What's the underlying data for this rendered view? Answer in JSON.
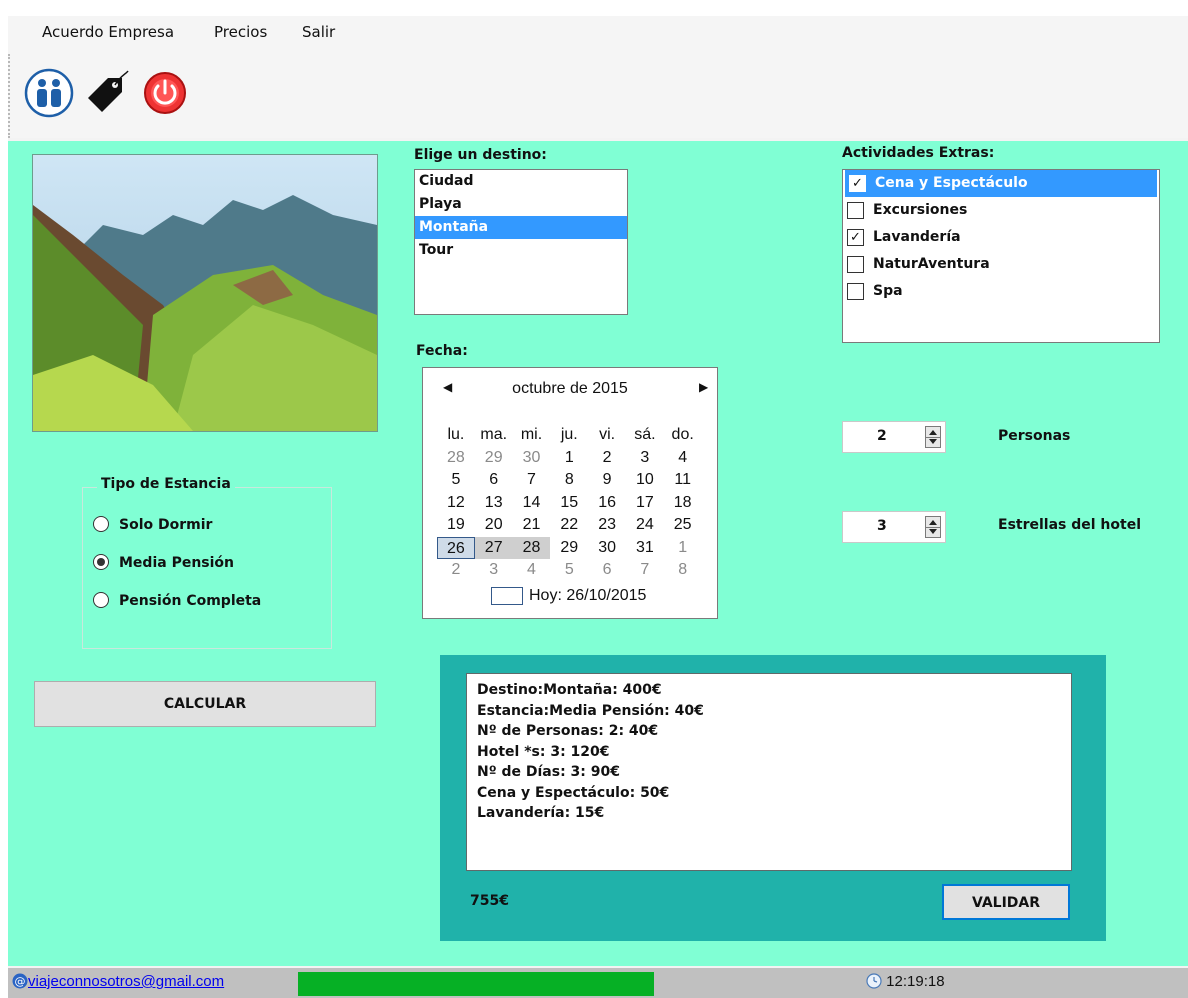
{
  "menu": {
    "items": [
      "Acuerdo Empresa",
      "Precios",
      "Salir"
    ]
  },
  "toolbar": {
    "icons": [
      "people-icon",
      "price-tag-icon",
      "power-icon"
    ]
  },
  "destino": {
    "label": "Elige un destino:",
    "options": [
      "Ciudad",
      "Playa",
      "Montaña",
      "Tour"
    ],
    "selected": "Montaña"
  },
  "actividades": {
    "label": "Actividades Extras:",
    "items": [
      {
        "label": "Cena y Espectáculo",
        "checked": true,
        "selected": true
      },
      {
        "label": "Excursiones",
        "checked": false,
        "selected": false
      },
      {
        "label": "Lavandería",
        "checked": true,
        "selected": false
      },
      {
        "label": "NaturAventura",
        "checked": false,
        "selected": false
      },
      {
        "label": "Spa",
        "checked": false,
        "selected": false
      }
    ]
  },
  "fecha": {
    "label": "Fecha:",
    "month_title": "octubre de 2015",
    "weekdays": [
      "lu.",
      "ma.",
      "mi.",
      "ju.",
      "vi.",
      "sá.",
      "do."
    ],
    "weeks": [
      [
        "28",
        "29",
        "30",
        "1",
        "2",
        "3",
        "4"
      ],
      [
        "5",
        "6",
        "7",
        "8",
        "9",
        "10",
        "11"
      ],
      [
        "12",
        "13",
        "14",
        "15",
        "16",
        "17",
        "18"
      ],
      [
        "19",
        "20",
        "21",
        "22",
        "23",
        "24",
        "25"
      ],
      [
        "26",
        "27",
        "28",
        "29",
        "30",
        "31",
        "1"
      ],
      [
        "2",
        "3",
        "4",
        "5",
        "6",
        "7",
        "8"
      ]
    ],
    "today_text": "Hoy: 26/10/2015"
  },
  "estancia": {
    "label": "Tipo de Estancia",
    "options": [
      "Solo Dormir",
      "Media Pensión",
      "Pensión Completa"
    ],
    "selected": "Media Pensión"
  },
  "calcular_label": "CALCULAR",
  "personas": {
    "value": "2",
    "label": "Personas"
  },
  "estrellas": {
    "value": "3",
    "label": "Estrellas del hotel"
  },
  "resultado": {
    "lines": [
      "Destino:Montaña: 400€",
      "Estancia:Media Pensión: 40€",
      "Nº de Personas: 2: 40€",
      "Hotel *s: 3: 120€",
      "Nº de Días: 3: 90€",
      "Cena y Espectáculo: 50€",
      "Lavandería: 15€"
    ],
    "total": "755€",
    "validar_label": "VALIDAR"
  },
  "status": {
    "email": "viajeconnosotros@gmail.com",
    "progress": 1.0,
    "time": "12:19:18"
  },
  "colors": {
    "main_bg": "#80ffd4",
    "panel_bg": "#20b2aa",
    "selection": "#3399ff",
    "progress": "#06b025"
  }
}
